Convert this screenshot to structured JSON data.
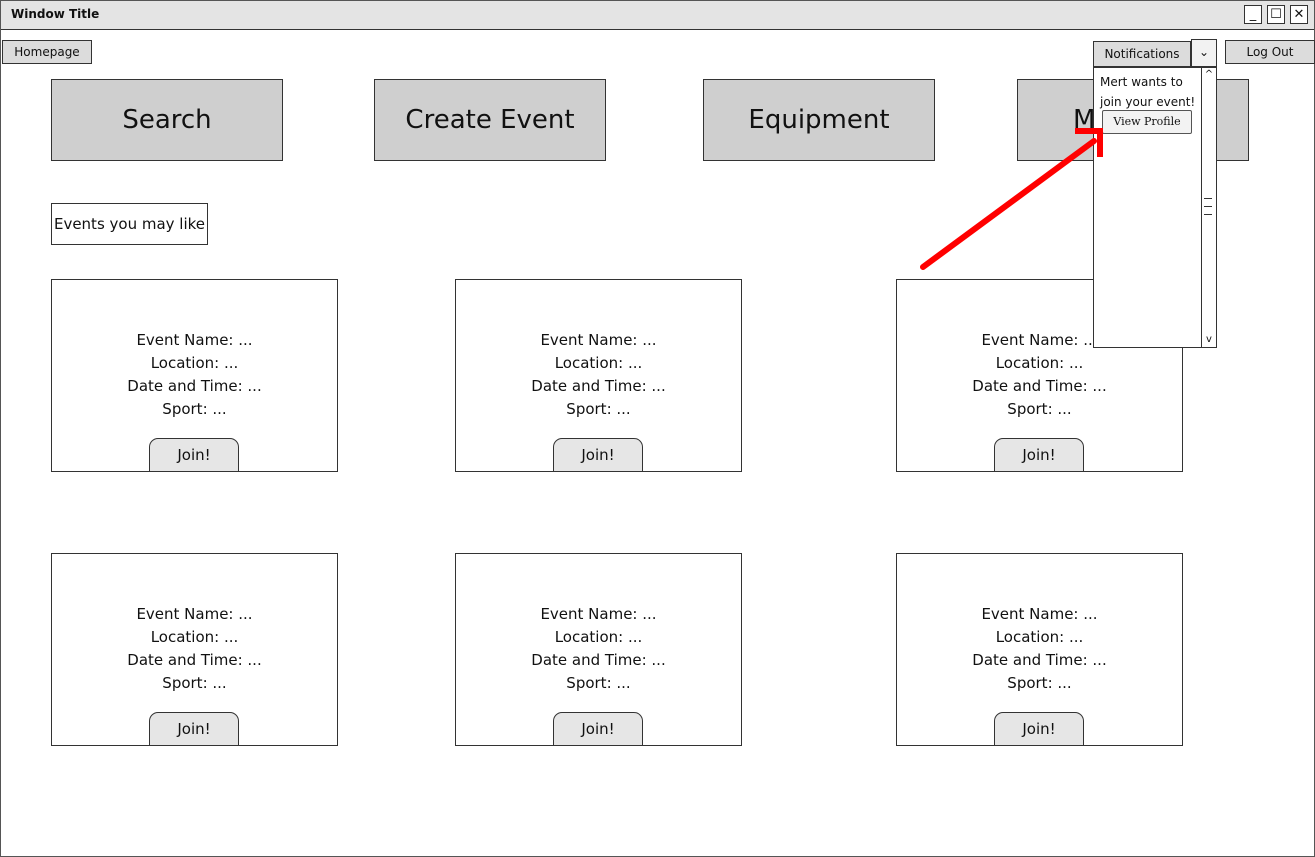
{
  "window": {
    "title": "Window Title",
    "minimize_glyph": "_",
    "maximize_glyph": "☐",
    "close_glyph": "✕"
  },
  "toolbar": {
    "homepage_label": "Homepage",
    "notifications_label": "Notifications",
    "dropdown_glyph": "⌄",
    "logout_label": "Log Out"
  },
  "main_buttons": [
    "Search",
    "Create Event",
    "Equipment",
    "M"
  ],
  "section_label": "Events you may like",
  "cards": [
    {
      "name": "Event Name: ...",
      "location": "Location: ...",
      "datetime": "Date and Time: ...",
      "sport": "Sport: ...",
      "join": "Join!"
    },
    {
      "name": "Event Name: ...",
      "location": "Location: ...",
      "datetime": "Date and Time: ...",
      "sport": "Sport: ...",
      "join": "Join!"
    },
    {
      "name": "Event Name: ...",
      "location": "Location: ...",
      "datetime": "Date and Time: ...",
      "sport": "Sport: ...",
      "join": "Join!"
    },
    {
      "name": "Event Name: ...",
      "location": "Location: ...",
      "datetime": "Date and Time: ...",
      "sport": "Sport: ...",
      "join": "Join!"
    },
    {
      "name": "Event Name: ...",
      "location": "Location: ...",
      "datetime": "Date and Time: ...",
      "sport": "Sport: ...",
      "join": "Join!"
    },
    {
      "name": "Event Name: ...",
      "location": "Location: ...",
      "datetime": "Date and Time: ...",
      "sport": "Sport: ...",
      "join": "Join!"
    }
  ],
  "notifications": {
    "message": "Mert wants to join your event!",
    "view_profile_label": "View Profile",
    "scroll_up_glyph": "^",
    "scroll_down_glyph": "v"
  },
  "colors": {
    "annotation_arrow": "#ff0000",
    "button_fill": "#cfcfcf"
  }
}
